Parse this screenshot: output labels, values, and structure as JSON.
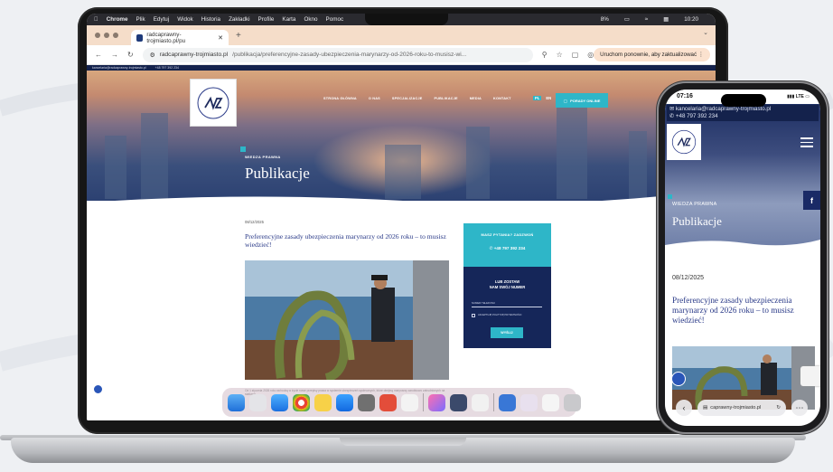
{
  "macos": {
    "menubar": {
      "app": "Chrome",
      "items": [
        "Plik",
        "Edytuj",
        "Widok",
        "Historia",
        "Zakładki",
        "Profile",
        "Karta",
        "Okno",
        "Pomoc"
      ],
      "battery": "8%",
      "clock": "10:20"
    }
  },
  "browser": {
    "tab_title": "radcaprawny-trojmiasto.pl/pu",
    "url_host": "radcaprawny-trojmiasto.pl",
    "url_path": "/publikacja/preferencyjne-zasady-ubezpieczenia-marynarzy-od-2026-roku-to-musisz-wi...",
    "relaunch_label": "Uruchom ponownie, aby zaktualizować"
  },
  "site": {
    "topbar_email": "kancelaria@radcaprawny-trojmiasto.pl",
    "topbar_phone": "+48 797 392 234",
    "nav": [
      "STRONA GŁÓWNA",
      "O NAS",
      "SPECJALIZACJE",
      "PUBLIKACJE",
      "MEDIA",
      "KONTAKT"
    ],
    "lang": [
      "PL",
      "EN"
    ],
    "cta": "PORADY ONLINE",
    "hero_kicker": "WIEDZA PRAWNA",
    "hero_title": "Publikacje",
    "post_date": "08/12/2025",
    "post_title": "Preferencyjne zasady ubezpieczenia marynarzy od 2026 roku – to musisz wiedzieć!",
    "excerpt": "Od 1 stycznia 2026 roku wchodzą w życie nowe przepisy prawa w systemie ubezpieczeń społecznych, które obejmą marynarzy zarobkowo zatrudnionych na statkach...",
    "sidebar": {
      "ask": "MASZ PYTANIA? ZADZWOŃ",
      "phone": "+48 797 392 234",
      "leave1": "LUB ZOSTAW",
      "leave2": "NAM SWÓJ NUMER",
      "tel_label": "NUMER TELEFONU",
      "consent": "AKCEPTUJĘ POLITYKĘ PRYWATNOŚCI",
      "send": "WYŚLIJ"
    }
  },
  "phone": {
    "time": "07:16",
    "signal": "LTE",
    "email": "kancelaria@radcaprawny-trojmiasto.pl",
    "phone": "+48 797 392 234",
    "kicker": "WIEDZA PRAWNA",
    "title": "Publikacje",
    "fb": "f",
    "date": "08/12/2025",
    "post_title": "Preferencyjne zasady ubezpieczenia marynarzy od 2026 roku – to musisz wiedzieć!",
    "address": "caprawny-trojmiasto.pl"
  },
  "colors": {
    "navy": "#14224c",
    "teal": "#2eb6c8",
    "title_blue": "#2a3a88"
  },
  "icons": [
    "apple-icon",
    "wifi-icon",
    "search-icon",
    "star-icon",
    "hamburger-icon",
    "facebook-icon",
    "accessibility-icon"
  ]
}
